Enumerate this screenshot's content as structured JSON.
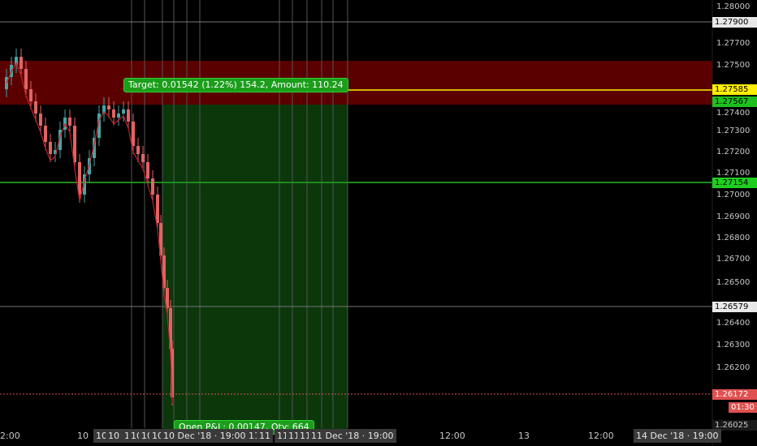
{
  "colors": {
    "background": "#000000",
    "stop_zone": "#5a0000",
    "profit_zone": "#0c3d0c",
    "entry_line": "#1e8a1e",
    "target_line": "#ffee00",
    "current_price_line": "#e05050",
    "candle_up": "#4aa3a3",
    "candle_down": "#e06464",
    "ma_line": "#c0202a",
    "gridline": "#3a3a3a"
  },
  "chart_data": {
    "type": "candlestick",
    "y_axis_ticks": [
      "1.28000",
      "1.27800",
      "1.27700",
      "1.27500",
      "1.27400",
      "1.27300",
      "1.27200",
      "1.27100",
      "1.27000",
      "1.26900",
      "1.26800",
      "1.26700",
      "1.26500",
      "1.26400",
      "1.26300",
      "1.26200",
      "1.26025"
    ],
    "price_tags": {
      "high_level": "1.27900",
      "target": "1.27585",
      "stop": "1.27567",
      "entry": "1.27154",
      "level": "1.26579",
      "current": "1.26172",
      "countdown": "01:30",
      "bottom": "1.26025"
    },
    "x_axis_ticks": [
      "2:00",
      "10",
      "10",
      "10",
      "10",
      "10",
      "10",
      "10",
      "10 Dec '18 · 19:00",
      "11",
      "11",
      "11",
      "11",
      "11",
      "11 Dec '18 · 19:00",
      "12:00",
      "13",
      "12:00",
      "14 Dec '18 · 19:00"
    ],
    "target_label": "Target: 0.01542 (1.22%) 154.2, Amount: 110.24",
    "open_pl_label": "Open P&L: 0.00147, Qty: 664",
    "ylim": [
      1.26025,
      1.28
    ]
  }
}
